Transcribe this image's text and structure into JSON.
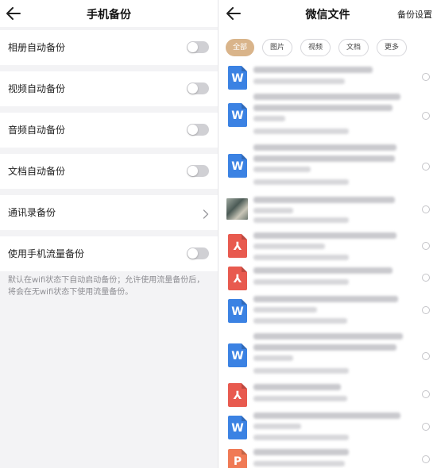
{
  "left": {
    "title": "手机备份",
    "rows": [
      {
        "label": "相册自动备份",
        "control": "toggle",
        "on": false
      },
      {
        "label": "视频自动备份",
        "control": "toggle",
        "on": false
      },
      {
        "label": "音频自动备份",
        "control": "toggle",
        "on": false
      },
      {
        "label": "文档自动备份",
        "control": "toggle",
        "on": false
      },
      {
        "label": "通讯录备份",
        "control": "chevron"
      },
      {
        "label": "使用手机流量备份",
        "control": "toggle",
        "on": false
      }
    ],
    "note": "默认在wifi状态下自动启动备份；允许使用流量备份后，将会在无wifi状态下使用流量备份。"
  },
  "right": {
    "title": "微信文件",
    "settings_label": "备份设置",
    "tabs": [
      {
        "label": "全部",
        "active": true
      },
      {
        "label": "图片",
        "active": false
      },
      {
        "label": "视频",
        "active": false
      },
      {
        "label": "文档",
        "active": false
      },
      {
        "label": "更多",
        "active": false
      }
    ],
    "files": [
      {
        "type": "word-icon"
      },
      {
        "type": "word-icon"
      },
      {
        "type": "word-icon"
      },
      {
        "type": "image-thumbnail"
      },
      {
        "type": "pdf-icon"
      },
      {
        "type": "pdf-icon"
      },
      {
        "type": "word-icon"
      },
      {
        "type": "word-icon"
      },
      {
        "type": "pdf-icon"
      },
      {
        "type": "word-icon"
      },
      {
        "type": "ppt-icon"
      }
    ]
  },
  "colors": {
    "active_tab": "#d9b48a",
    "word_icon": "#3b82e3",
    "pdf_icon": "#e85a4f",
    "ppt_icon": "#f07a55",
    "toggle_off": "#d0d0d4",
    "background": "#f3f3f5"
  }
}
